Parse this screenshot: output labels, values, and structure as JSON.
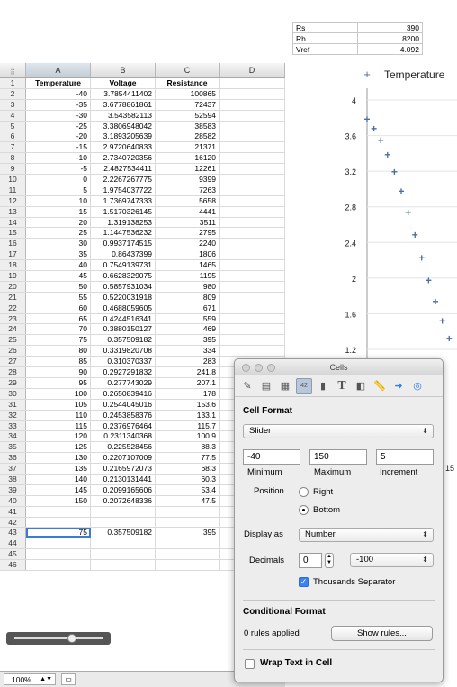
{
  "params": [
    {
      "key": "Rs",
      "value": "390"
    },
    {
      "key": "Rh",
      "value": "8200"
    },
    {
      "key": "Vref",
      "value": "4.092"
    }
  ],
  "sheet": {
    "corner": "⣿",
    "columns": [
      "A",
      "B",
      "C",
      "D"
    ],
    "headers": [
      "Temperature",
      "Voltage",
      "Resistance"
    ],
    "rows": [
      [
        "-40",
        "3.7854411402",
        "100865"
      ],
      [
        "-35",
        "3.6778861861",
        "72437"
      ],
      [
        "-30",
        "3.543582113",
        "52594"
      ],
      [
        "-25",
        "3.3806948042",
        "38583"
      ],
      [
        "-20",
        "3.1893205639",
        "28582"
      ],
      [
        "-15",
        "2.9720640833",
        "21371"
      ],
      [
        "-10",
        "2.7340720356",
        "16120"
      ],
      [
        "-5",
        "2.4827534411",
        "12261"
      ],
      [
        "0",
        "2.2267267775",
        "9399"
      ],
      [
        "5",
        "1.9754037722",
        "7263"
      ],
      [
        "10",
        "1.7369747333",
        "5658"
      ],
      [
        "15",
        "1.5170326145",
        "4441"
      ],
      [
        "20",
        "1.319138253",
        "3511"
      ],
      [
        "25",
        "1.1447536232",
        "2795"
      ],
      [
        "30",
        "0.9937174515",
        "2240"
      ],
      [
        "35",
        "0.86437399",
        "1806"
      ],
      [
        "40",
        "0.7549139731",
        "1465"
      ],
      [
        "45",
        "0.6628329075",
        "1195"
      ],
      [
        "50",
        "0.5857931034",
        "980"
      ],
      [
        "55",
        "0.5220031918",
        "809"
      ],
      [
        "60",
        "0.4688059605",
        "671"
      ],
      [
        "65",
        "0.4244516341",
        "559"
      ],
      [
        "70",
        "0.3880150127",
        "469"
      ],
      [
        "75",
        "0.357509182",
        "395"
      ],
      [
        "80",
        "0.3319820708",
        "334"
      ],
      [
        "85",
        "0.310370337",
        "283"
      ],
      [
        "90",
        "0.2927291832",
        "241.8"
      ],
      [
        "95",
        "0.277743029",
        "207.1"
      ],
      [
        "100",
        "0.2650839416",
        "178"
      ],
      [
        "105",
        "0.2544045016",
        "153.6"
      ],
      [
        "110",
        "0.2453858376",
        "133.1"
      ],
      [
        "115",
        "0.2376976464",
        "115.7"
      ],
      [
        "120",
        "0.2311340368",
        "100.9"
      ],
      [
        "125",
        "0.225528456",
        "88.3"
      ],
      [
        "130",
        "0.2207107009",
        "77.5"
      ],
      [
        "135",
        "0.2165972073",
        "68.3"
      ],
      [
        "140",
        "0.2130131441",
        "60.3"
      ],
      [
        "145",
        "0.2099165606",
        "53.4"
      ],
      [
        "150",
        "0.2072648336",
        "47.5"
      ]
    ],
    "row43": [
      "75",
      "0.357509182",
      "395"
    ],
    "zoom": "100%"
  },
  "chart_data": {
    "type": "scatter",
    "legend": "Temperature",
    "legend_position": "top",
    "y_ticks": [
      "4",
      "3.6",
      "3.2",
      "2.8",
      "2.4",
      "2",
      "1.6",
      "1.2"
    ],
    "x_tick_visible": "15",
    "ylim": [
      1.2,
      4.0
    ],
    "points": [
      {
        "x": -40,
        "y": 3.785
      },
      {
        "x": -35,
        "y": 3.678
      },
      {
        "x": -30,
        "y": 3.544
      },
      {
        "x": -25,
        "y": 3.381
      },
      {
        "x": -20,
        "y": 3.189
      },
      {
        "x": -15,
        "y": 2.972
      },
      {
        "x": -10,
        "y": 2.734
      },
      {
        "x": -5,
        "y": 2.483
      },
      {
        "x": 0,
        "y": 2.227
      },
      {
        "x": 5,
        "y": 1.975
      },
      {
        "x": 10,
        "y": 1.737
      },
      {
        "x": 15,
        "y": 1.517
      },
      {
        "x": 20,
        "y": 1.319
      }
    ],
    "marker_color": "#4a6fa5"
  },
  "inspector": {
    "title": "Cells",
    "cell_format_heading": "Cell Format",
    "format_value": "Slider",
    "minimum": "-40",
    "maximum": "150",
    "increment": "5",
    "minimum_label": "Minimum",
    "maximum_label": "Maximum",
    "increment_label": "Increment",
    "position_label": "Position",
    "position_right": "Right",
    "position_bottom": "Bottom",
    "display_as_label": "Display as",
    "display_as_value": "Number",
    "decimals_label": "Decimals",
    "decimals_value": "0",
    "negative_format": "-100",
    "thousands_label": "Thousands Separator",
    "conditional_heading": "Conditional Format",
    "rules_applied": "0 rules applied",
    "show_rules": "Show rules...",
    "wrap_text": "Wrap Text in Cell",
    "toolbar_active_badge": "42"
  }
}
